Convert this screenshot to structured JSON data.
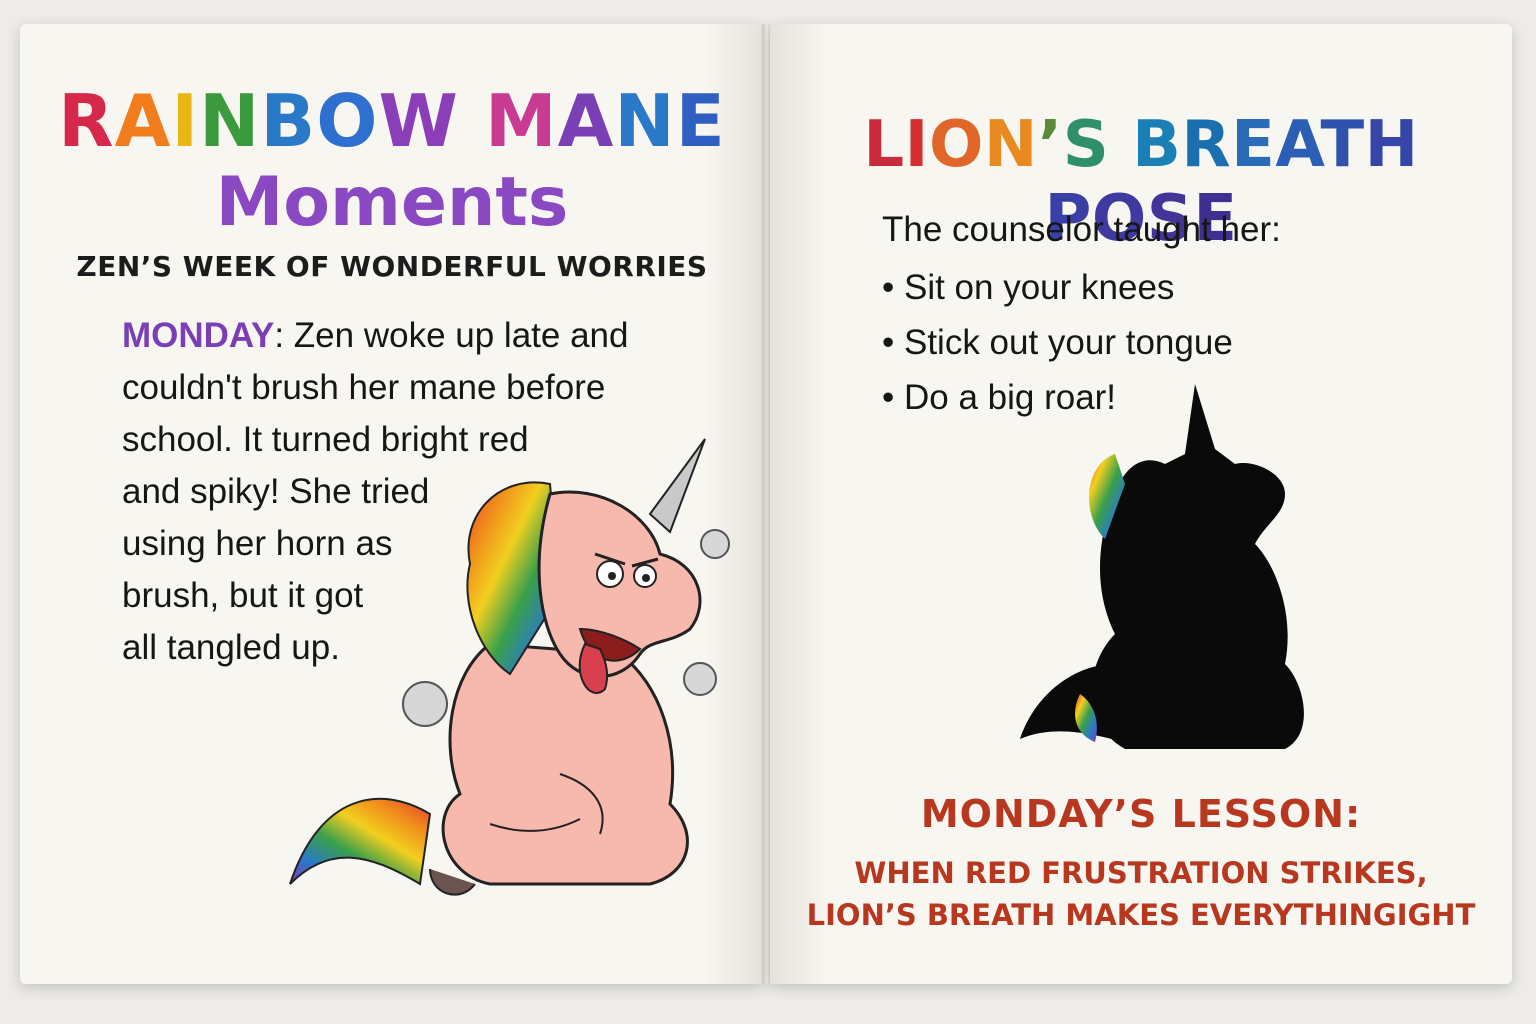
{
  "left_page": {
    "title_line1": [
      "R",
      "A",
      "I",
      "N",
      "B",
      "O",
      "W",
      " ",
      "M",
      "A",
      "N",
      "E"
    ],
    "title_line1_colors": [
      "#d6284a",
      "#f07c1c",
      "#e9b616",
      "#3a9a3d",
      "#2a78c8",
      "#2f6fd0",
      "#8a3fb8",
      "#000",
      "#c93a92",
      "#7a3fb5",
      "#2a78c8",
      "#2f5fc0"
    ],
    "title_line2": "Moments",
    "subtitle": "ZEN’S WEEK OF WONDERFUL WORRIES",
    "story": {
      "day": "MONDAY",
      "line1": ": Zen woke up late and",
      "line2": "couldn't brush her mane before",
      "line3": "school. It turned bright red",
      "line4": "and spiky! She tried",
      "line5": "using her horn as",
      "line6": "brush, but it got",
      "line7": "all tangled up."
    },
    "illustration": "angry-unicorn-icon"
  },
  "right_page": {
    "title": [
      "L",
      "I",
      "O",
      "N",
      "’",
      "S",
      " ",
      "B",
      "R",
      "E",
      "A",
      "T",
      "H",
      " ",
      "P",
      "O",
      "S",
      "E"
    ],
    "title_colors": [
      "#c92a3c",
      "#d4302f",
      "#e0662a",
      "#e98a21",
      "#5b8a3a",
      "#2f8f6a",
      "#000",
      "#1a7fb5",
      "#1a6fb0",
      "#2a6cb8",
      "#2a5fb5",
      "#2f52ad",
      "#3546a8",
      "#000",
      "#3a3fa5",
      "#3f3aa0",
      "#433598",
      "#3e2f90"
    ],
    "lead": "The counselor taught her:",
    "bullets": [
      "Sit on your knees",
      "Stick out your tongue",
      "Do a big roar!"
    ],
    "illustration": "unicorn-silhouette-icon",
    "lesson_head": "MONDAY’S LESSON:",
    "lesson_line1": "WHEN RED FRUSTRATION STRIKES,",
    "lesson_line2": "LION’S BREATH MAKES EVERYTHINGIGHT"
  }
}
